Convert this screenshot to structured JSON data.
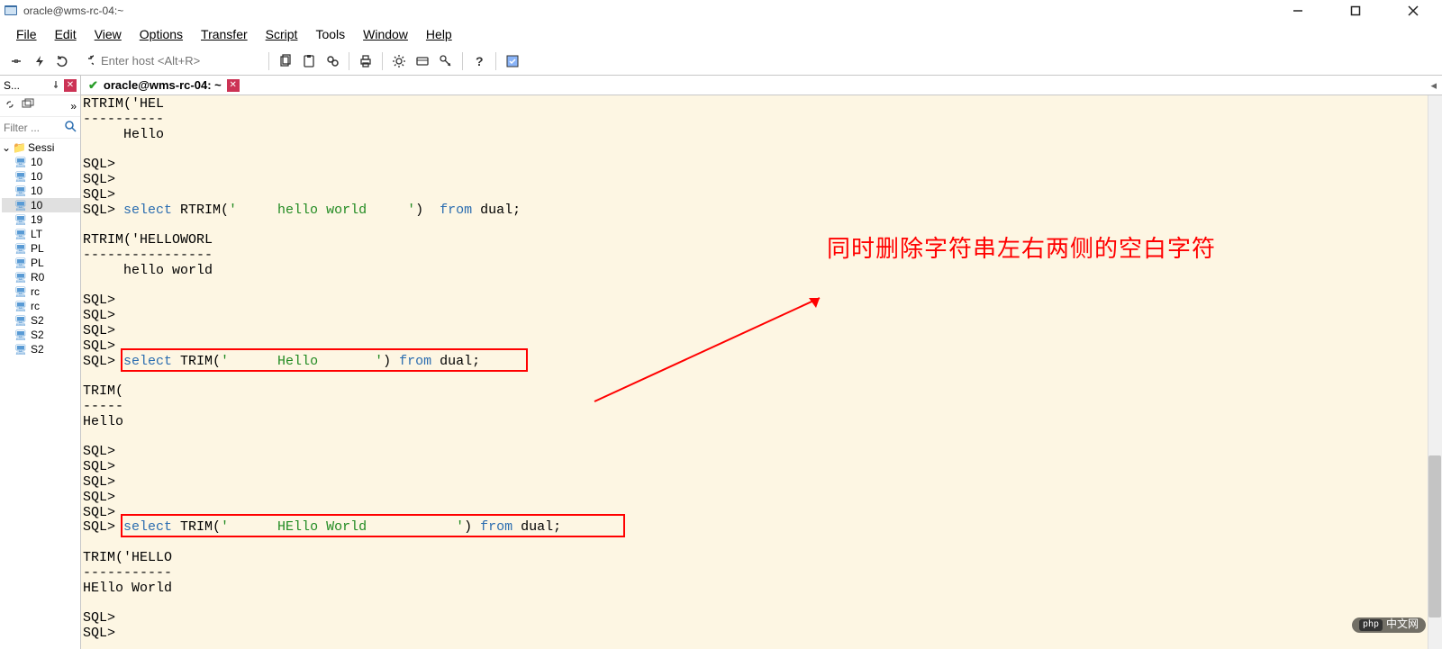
{
  "window": {
    "title": "oracle@wms-rc-04:~"
  },
  "menu": {
    "file": "File",
    "edit": "Edit",
    "view": "View",
    "options": "Options",
    "transfer": "Transfer",
    "script": "Script",
    "tools": "Tools",
    "window": "Window",
    "help": "Help"
  },
  "toolbar": {
    "host_placeholder": "Enter host <Alt+R>"
  },
  "side": {
    "head": "S...",
    "filter_placeholder": "Filter ...",
    "root": "Sessi",
    "items": [
      "10",
      "10",
      "10",
      "10",
      "19",
      "LT",
      "PL",
      "PL",
      "R0",
      "rc",
      "rc",
      "S2",
      "S2",
      "S2"
    ],
    "selected_index": 3
  },
  "tab": {
    "title": "oracle@wms-rc-04: ~"
  },
  "terminal": {
    "lines": [
      {
        "t": "plain",
        "v": "RTRIM('HEL"
      },
      {
        "t": "plain",
        "v": "----------"
      },
      {
        "t": "plain",
        "v": "     Hello"
      },
      {
        "t": "plain",
        "v": ""
      },
      {
        "t": "prompt",
        "v": "SQL>"
      },
      {
        "t": "prompt",
        "v": "SQL>"
      },
      {
        "t": "prompt",
        "v": "SQL>"
      },
      {
        "t": "sql",
        "pre": "SQL> ",
        "kw1": "select",
        "mid": " RTRIM(",
        "str": "'     hello world     '",
        "post": ")  ",
        "kw2": "from",
        "tail": " dual;"
      },
      {
        "t": "plain",
        "v": ""
      },
      {
        "t": "plain",
        "v": "RTRIM('HELLOWORL"
      },
      {
        "t": "plain",
        "v": "----------------"
      },
      {
        "t": "plain",
        "v": "     hello world"
      },
      {
        "t": "plain",
        "v": ""
      },
      {
        "t": "prompt",
        "v": "SQL>"
      },
      {
        "t": "prompt",
        "v": "SQL>"
      },
      {
        "t": "prompt",
        "v": "SQL>"
      },
      {
        "t": "prompt",
        "v": "SQL>"
      },
      {
        "t": "sql",
        "pre": "SQL> ",
        "kw1": "select",
        "mid": " TRIM(",
        "str": "'      Hello       '",
        "post": ") ",
        "kw2": "from",
        "tail": " dual;"
      },
      {
        "t": "plain",
        "v": ""
      },
      {
        "t": "plain",
        "v": "TRIM("
      },
      {
        "t": "plain",
        "v": "-----"
      },
      {
        "t": "plain",
        "v": "Hello"
      },
      {
        "t": "plain",
        "v": ""
      },
      {
        "t": "prompt",
        "v": "SQL>"
      },
      {
        "t": "prompt",
        "v": "SQL>"
      },
      {
        "t": "prompt",
        "v": "SQL>"
      },
      {
        "t": "prompt",
        "v": "SQL>"
      },
      {
        "t": "prompt",
        "v": "SQL>"
      },
      {
        "t": "sql",
        "pre": "SQL> ",
        "kw1": "select",
        "mid": " TRIM(",
        "str": "'      HEllo World           '",
        "post": ") ",
        "kw2": "from",
        "tail": " dual;"
      },
      {
        "t": "plain",
        "v": ""
      },
      {
        "t": "plain",
        "v": "TRIM('HELLO"
      },
      {
        "t": "plain",
        "v": "-----------"
      },
      {
        "t": "plain",
        "v": "HEllo World"
      },
      {
        "t": "plain",
        "v": ""
      },
      {
        "t": "prompt",
        "v": "SQL>"
      },
      {
        "t": "prompt",
        "v": "SQL>"
      }
    ]
  },
  "annotation": {
    "text": "同时删除字符串左右两侧的空白字符"
  },
  "watermark": {
    "badge": "php",
    "text": "中文网"
  }
}
